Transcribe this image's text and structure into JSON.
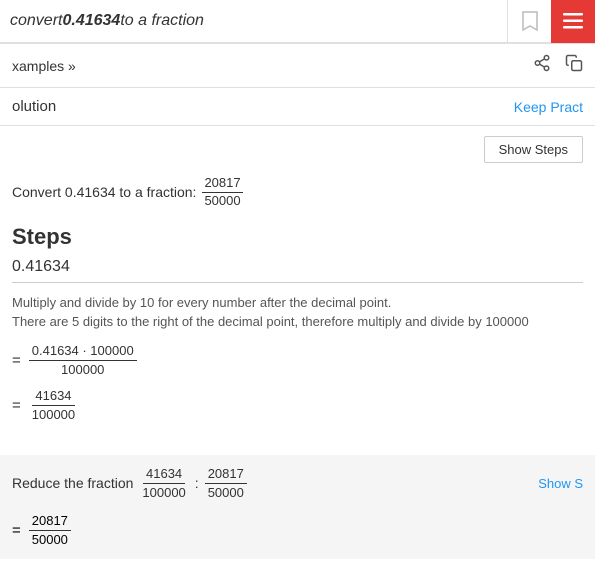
{
  "header": {
    "search_text_prefix": "convert ",
    "search_keyword": "0.41634",
    "search_text_suffix": " to a fraction",
    "bookmark_icon": "🔖",
    "red_btn_icon": "≡"
  },
  "sub_header": {
    "examples_label": "xamples »",
    "share_icon": "share",
    "doc_icon": "doc"
  },
  "solution_section": {
    "title": "olution",
    "keep_practice_label": "Keep Pract"
  },
  "show_steps": {
    "button_label": "Show Steps"
  },
  "convert_result": {
    "label": "Convert 0.41634 to a fraction:",
    "numerator": "20817",
    "denominator": "50000"
  },
  "steps": {
    "heading": "Steps",
    "decimal": "0.41634",
    "description_line1": "Multiply and divide by 10 for every number after the decimal point.",
    "description_line2": "There are 5 digits to the right of the decimal point, therefore multiply and divide by 100000",
    "eq1": {
      "sign": "=",
      "numerator": "0.41634 · 100000",
      "denominator": "100000"
    },
    "eq2": {
      "sign": "=",
      "numerator": "41634",
      "denominator": "100000"
    }
  },
  "reduce": {
    "label": "Reduce the fraction",
    "fraction1_num": "41634",
    "fraction1_den": "100000",
    "colon": ":",
    "fraction2_num": "20817",
    "fraction2_den": "50000",
    "show_steps_link": "Show S",
    "result_sign": "=",
    "result_num": "20817",
    "result_den": "50000"
  }
}
